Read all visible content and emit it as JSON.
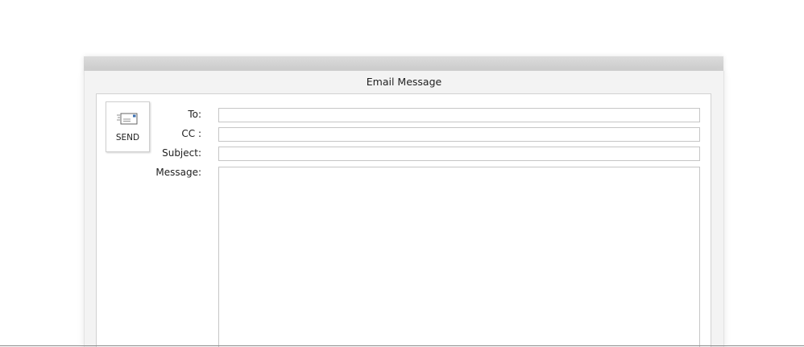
{
  "window": {
    "title": "Email Message"
  },
  "send_button": {
    "label": "SEND",
    "icon": "envelope-icon"
  },
  "fields": {
    "to_label": "To:",
    "to_value": "",
    "cc_label": "CC :",
    "cc_value": "",
    "subject_label": "Subject:",
    "subject_value": "",
    "message_label": "Message:",
    "message_value": ""
  },
  "colors": {
    "background": "#ffffff",
    "window_bg": "#f3f3f3",
    "border": "#c6c6c6",
    "text": "#1e1e1e",
    "envelope_accent": "#3a6fb0"
  }
}
